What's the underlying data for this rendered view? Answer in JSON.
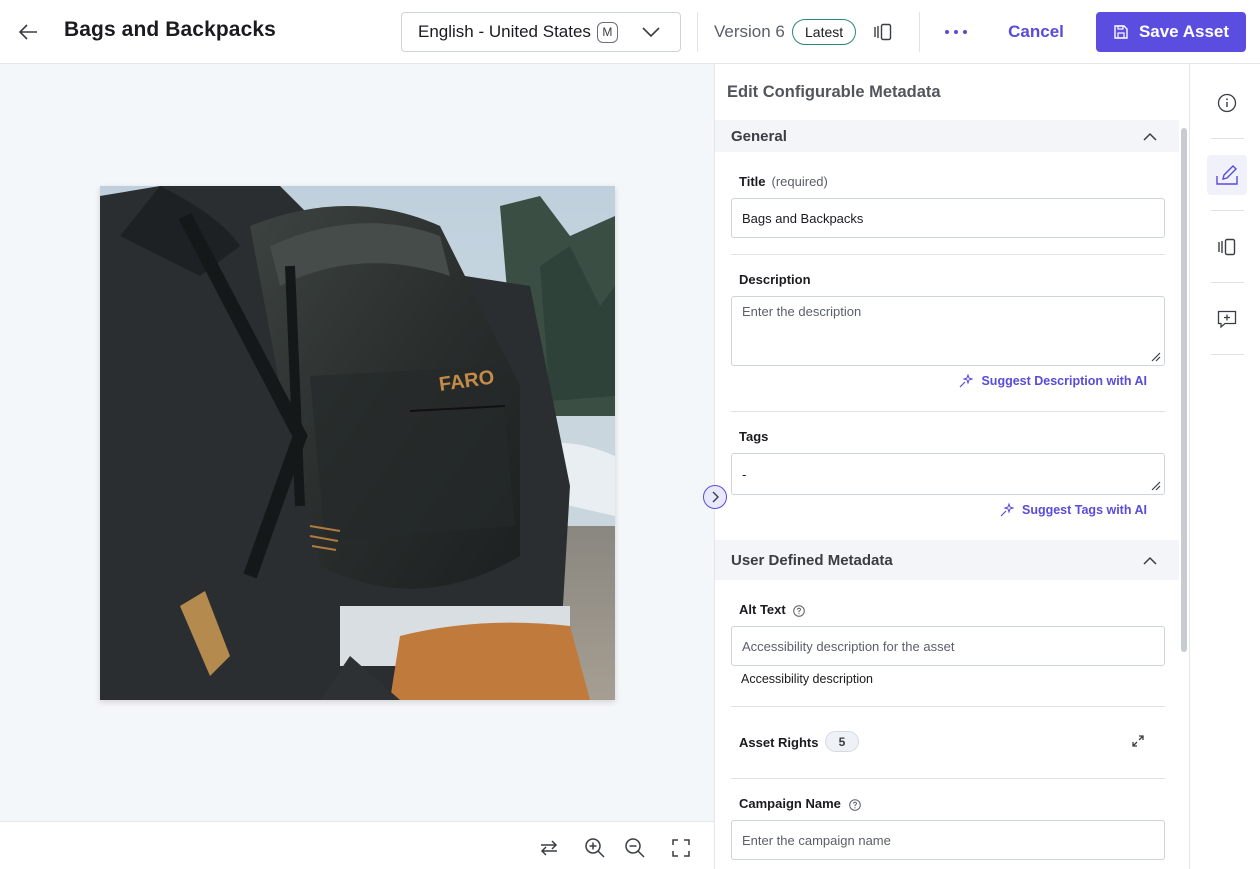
{
  "header": {
    "title": "Bags and Backpacks",
    "locale": "English - United States",
    "locale_badge": "M",
    "version_label": "Version 6",
    "latest_badge": "Latest",
    "cancel_label": "Cancel",
    "save_label": "Save Asset"
  },
  "asset": {
    "bag_brand_text": "FARO"
  },
  "panel": {
    "title": "Edit Configurable Metadata",
    "general": {
      "heading": "General",
      "title_field": {
        "label": "Title",
        "required": "(required)",
        "value": "Bags and Backpacks"
      },
      "description_field": {
        "label": "Description",
        "placeholder": "Enter the description",
        "ai_label": "Suggest Description with AI"
      },
      "tags_field": {
        "label": "Tags",
        "value": "-",
        "ai_label": "Suggest Tags with AI"
      }
    },
    "user_defined": {
      "heading": "User Defined Metadata",
      "alt_text": {
        "label": "Alt Text",
        "placeholder": "Accessibility description for the asset",
        "helper": "Accessibility description"
      },
      "asset_rights": {
        "label": "Asset Rights",
        "count": "5"
      },
      "campaign_name": {
        "label": "Campaign Name",
        "placeholder": "Enter the campaign name"
      }
    }
  },
  "colors": {
    "accent": "#5b4de0",
    "latest_badge_border": "#2a8a7a",
    "preview_bg": "#f4f7fa"
  },
  "icons": {
    "toolbar": [
      "swap-icon",
      "zoom-in-icon",
      "zoom-out-icon",
      "fullscreen-icon"
    ],
    "rail": [
      "info-icon",
      "edit-metadata-icon",
      "compare-versions-icon",
      "comment-icon"
    ]
  }
}
